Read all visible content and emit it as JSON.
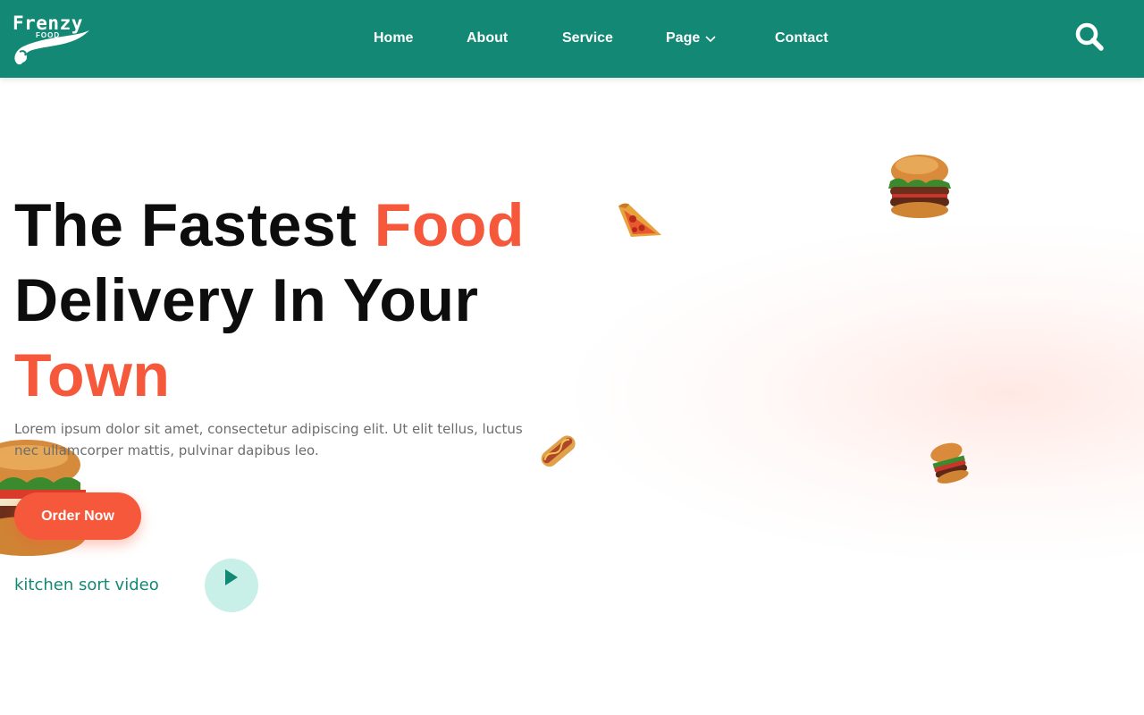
{
  "brand": {
    "name": "Frenzy",
    "sub": "FOOD"
  },
  "nav": {
    "home": "Home",
    "about": "About",
    "service": "Service",
    "page": "Page",
    "contact": "Contact"
  },
  "hero": {
    "title_part1": "The Fastest ",
    "title_accent1": "Food",
    "title_part2": "Delivery In Your",
    "title_accent2": "Town",
    "description": "Lorem ipsum dolor sit amet, consectetur adipiscing elit. Ut elit tellus, luctus nec ullamcorper mattis, pulvinar dapibus leo.",
    "order_button": "Order Now",
    "video_label": "kitchen sort video"
  },
  "colors": {
    "primary": "#138874",
    "accent": "#f5583a",
    "play_bg": "#c8f0e8"
  },
  "icons": [
    "search-icon",
    "chevron-down-icon",
    "play-icon"
  ]
}
